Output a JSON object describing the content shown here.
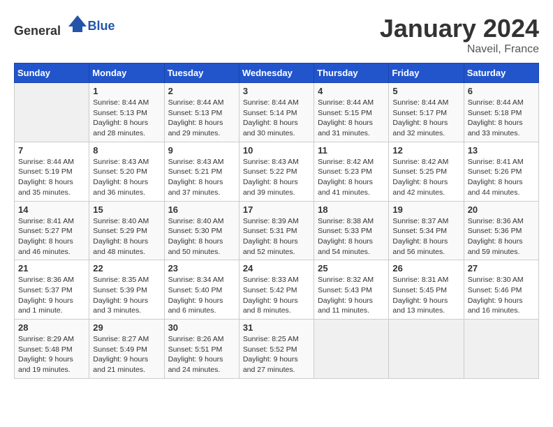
{
  "logo": {
    "text_general": "General",
    "text_blue": "Blue"
  },
  "title": "January 2024",
  "location": "Naveil, France",
  "days_of_week": [
    "Sunday",
    "Monday",
    "Tuesday",
    "Wednesday",
    "Thursday",
    "Friday",
    "Saturday"
  ],
  "weeks": [
    [
      {
        "day": "",
        "sunrise": "",
        "sunset": "",
        "daylight": ""
      },
      {
        "day": "1",
        "sunrise": "8:44 AM",
        "sunset": "5:13 PM",
        "daylight": "8 hours and 28 minutes."
      },
      {
        "day": "2",
        "sunrise": "8:44 AM",
        "sunset": "5:13 PM",
        "daylight": "8 hours and 29 minutes."
      },
      {
        "day": "3",
        "sunrise": "8:44 AM",
        "sunset": "5:14 PM",
        "daylight": "8 hours and 30 minutes."
      },
      {
        "day": "4",
        "sunrise": "8:44 AM",
        "sunset": "5:15 PM",
        "daylight": "8 hours and 31 minutes."
      },
      {
        "day": "5",
        "sunrise": "8:44 AM",
        "sunset": "5:17 PM",
        "daylight": "8 hours and 32 minutes."
      },
      {
        "day": "6",
        "sunrise": "8:44 AM",
        "sunset": "5:18 PM",
        "daylight": "8 hours and 33 minutes."
      }
    ],
    [
      {
        "day": "7",
        "sunrise": "8:44 AM",
        "sunset": "5:19 PM",
        "daylight": "8 hours and 35 minutes."
      },
      {
        "day": "8",
        "sunrise": "8:43 AM",
        "sunset": "5:20 PM",
        "daylight": "8 hours and 36 minutes."
      },
      {
        "day": "9",
        "sunrise": "8:43 AM",
        "sunset": "5:21 PM",
        "daylight": "8 hours and 37 minutes."
      },
      {
        "day": "10",
        "sunrise": "8:43 AM",
        "sunset": "5:22 PM",
        "daylight": "8 hours and 39 minutes."
      },
      {
        "day": "11",
        "sunrise": "8:42 AM",
        "sunset": "5:23 PM",
        "daylight": "8 hours and 41 minutes."
      },
      {
        "day": "12",
        "sunrise": "8:42 AM",
        "sunset": "5:25 PM",
        "daylight": "8 hours and 42 minutes."
      },
      {
        "day": "13",
        "sunrise": "8:41 AM",
        "sunset": "5:26 PM",
        "daylight": "8 hours and 44 minutes."
      }
    ],
    [
      {
        "day": "14",
        "sunrise": "8:41 AM",
        "sunset": "5:27 PM",
        "daylight": "8 hours and 46 minutes."
      },
      {
        "day": "15",
        "sunrise": "8:40 AM",
        "sunset": "5:29 PM",
        "daylight": "8 hours and 48 minutes."
      },
      {
        "day": "16",
        "sunrise": "8:40 AM",
        "sunset": "5:30 PM",
        "daylight": "8 hours and 50 minutes."
      },
      {
        "day": "17",
        "sunrise": "8:39 AM",
        "sunset": "5:31 PM",
        "daylight": "8 hours and 52 minutes."
      },
      {
        "day": "18",
        "sunrise": "8:38 AM",
        "sunset": "5:33 PM",
        "daylight": "8 hours and 54 minutes."
      },
      {
        "day": "19",
        "sunrise": "8:37 AM",
        "sunset": "5:34 PM",
        "daylight": "8 hours and 56 minutes."
      },
      {
        "day": "20",
        "sunrise": "8:36 AM",
        "sunset": "5:36 PM",
        "daylight": "8 hours and 59 minutes."
      }
    ],
    [
      {
        "day": "21",
        "sunrise": "8:36 AM",
        "sunset": "5:37 PM",
        "daylight": "9 hours and 1 minute."
      },
      {
        "day": "22",
        "sunrise": "8:35 AM",
        "sunset": "5:39 PM",
        "daylight": "9 hours and 3 minutes."
      },
      {
        "day": "23",
        "sunrise": "8:34 AM",
        "sunset": "5:40 PM",
        "daylight": "9 hours and 6 minutes."
      },
      {
        "day": "24",
        "sunrise": "8:33 AM",
        "sunset": "5:42 PM",
        "daylight": "9 hours and 8 minutes."
      },
      {
        "day": "25",
        "sunrise": "8:32 AM",
        "sunset": "5:43 PM",
        "daylight": "9 hours and 11 minutes."
      },
      {
        "day": "26",
        "sunrise": "8:31 AM",
        "sunset": "5:45 PM",
        "daylight": "9 hours and 13 minutes."
      },
      {
        "day": "27",
        "sunrise": "8:30 AM",
        "sunset": "5:46 PM",
        "daylight": "9 hours and 16 minutes."
      }
    ],
    [
      {
        "day": "28",
        "sunrise": "8:29 AM",
        "sunset": "5:48 PM",
        "daylight": "9 hours and 19 minutes."
      },
      {
        "day": "29",
        "sunrise": "8:27 AM",
        "sunset": "5:49 PM",
        "daylight": "9 hours and 21 minutes."
      },
      {
        "day": "30",
        "sunrise": "8:26 AM",
        "sunset": "5:51 PM",
        "daylight": "9 hours and 24 minutes."
      },
      {
        "day": "31",
        "sunrise": "8:25 AM",
        "sunset": "5:52 PM",
        "daylight": "9 hours and 27 minutes."
      },
      {
        "day": "",
        "sunrise": "",
        "sunset": "",
        "daylight": ""
      },
      {
        "day": "",
        "sunrise": "",
        "sunset": "",
        "daylight": ""
      },
      {
        "day": "",
        "sunrise": "",
        "sunset": "",
        "daylight": ""
      }
    ]
  ]
}
